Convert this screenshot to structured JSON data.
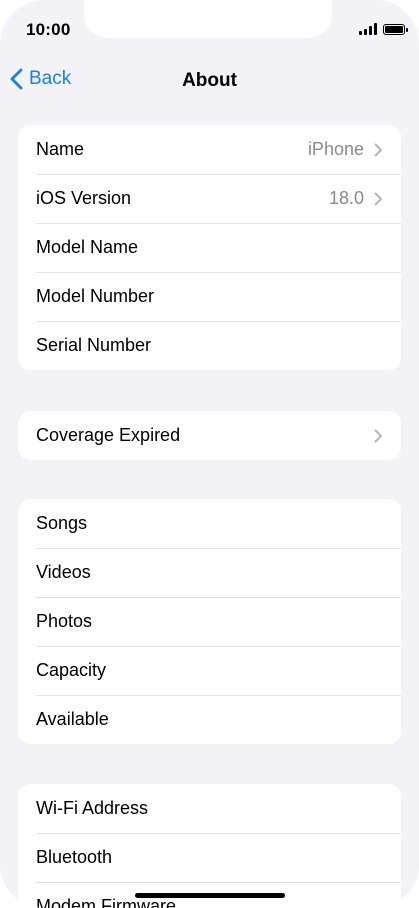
{
  "status_bar": {
    "time": "10:00"
  },
  "nav": {
    "back_label": "Back",
    "title": "About"
  },
  "group1": [
    {
      "label": "Name",
      "value": "iPhone",
      "chevron": true
    },
    {
      "label": "iOS Version",
      "value": "18.0",
      "chevron": true
    },
    {
      "label": "Model Name",
      "value": "",
      "chevron": false
    },
    {
      "label": "Model Number",
      "value": "",
      "chevron": false
    },
    {
      "label": "Serial Number",
      "value": "",
      "chevron": false
    }
  ],
  "group2": [
    {
      "label": "Coverage Expired",
      "value": "",
      "chevron": true
    }
  ],
  "group3": [
    {
      "label": "Songs"
    },
    {
      "label": "Videos"
    },
    {
      "label": "Photos"
    },
    {
      "label": "Capacity"
    },
    {
      "label": "Available"
    }
  ],
  "group4": [
    {
      "label": "Wi-Fi Address"
    },
    {
      "label": "Bluetooth"
    },
    {
      "label": "Modem Firmware"
    }
  ],
  "colors": {
    "accent": "#1a7ee6",
    "background": "#f2f2f7",
    "secondary_text": "#8a8a8e"
  }
}
